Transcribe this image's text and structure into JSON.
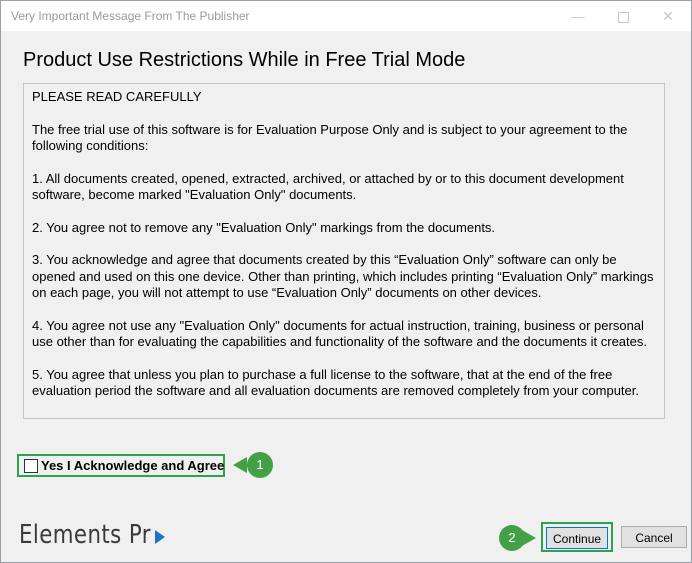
{
  "window": {
    "title": "Very Important Message From The Publisher",
    "controls": {
      "minimize": "—",
      "close": "✕"
    }
  },
  "heading": "Product Use Restrictions While in Free Trial Mode",
  "body_paragraphs": [
    "PLEASE READ CAREFULLY",
    "The free trial use of this software is for Evaluation Purpose Only and is subject to your agreement to the following conditions:",
    "1. All documents created, opened, extracted, archived, or attached by or to this document development software, become marked \"Evaluation Only\" documents.",
    "2. You agree not to remove any \"Evaluation Only\" markings from the documents.",
    "3. You acknowledge and agree that documents created by this “Evaluation Only” software can only be opened and used on this one device. Other than printing, which includes printing “Evaluation Only” markings on each page, you will not attempt to use “Evaluation Only” documents on other devices.",
    "4. You agree not use any \"Evaluation Only\" documents for actual instruction, training, business or personal use other than for evaluating the capabilities and functionality of the software and the documents it creates.",
    "5. You agree that unless you plan to purchase a full license to the software, that at the end of the free evaluation period the software and all evaluation documents are removed completely from your computer."
  ],
  "agree": {
    "label": "Yes I Acknowledge and Agree",
    "checked": false
  },
  "callouts": [
    "1",
    "2"
  ],
  "logo": {
    "text": "Elements Pr",
    "accent_color": "#1a75c4"
  },
  "buttons": {
    "continue": "Continue",
    "cancel": "Cancel"
  },
  "colors": {
    "highlight": "#2fa24b",
    "callout": "#43a047"
  }
}
